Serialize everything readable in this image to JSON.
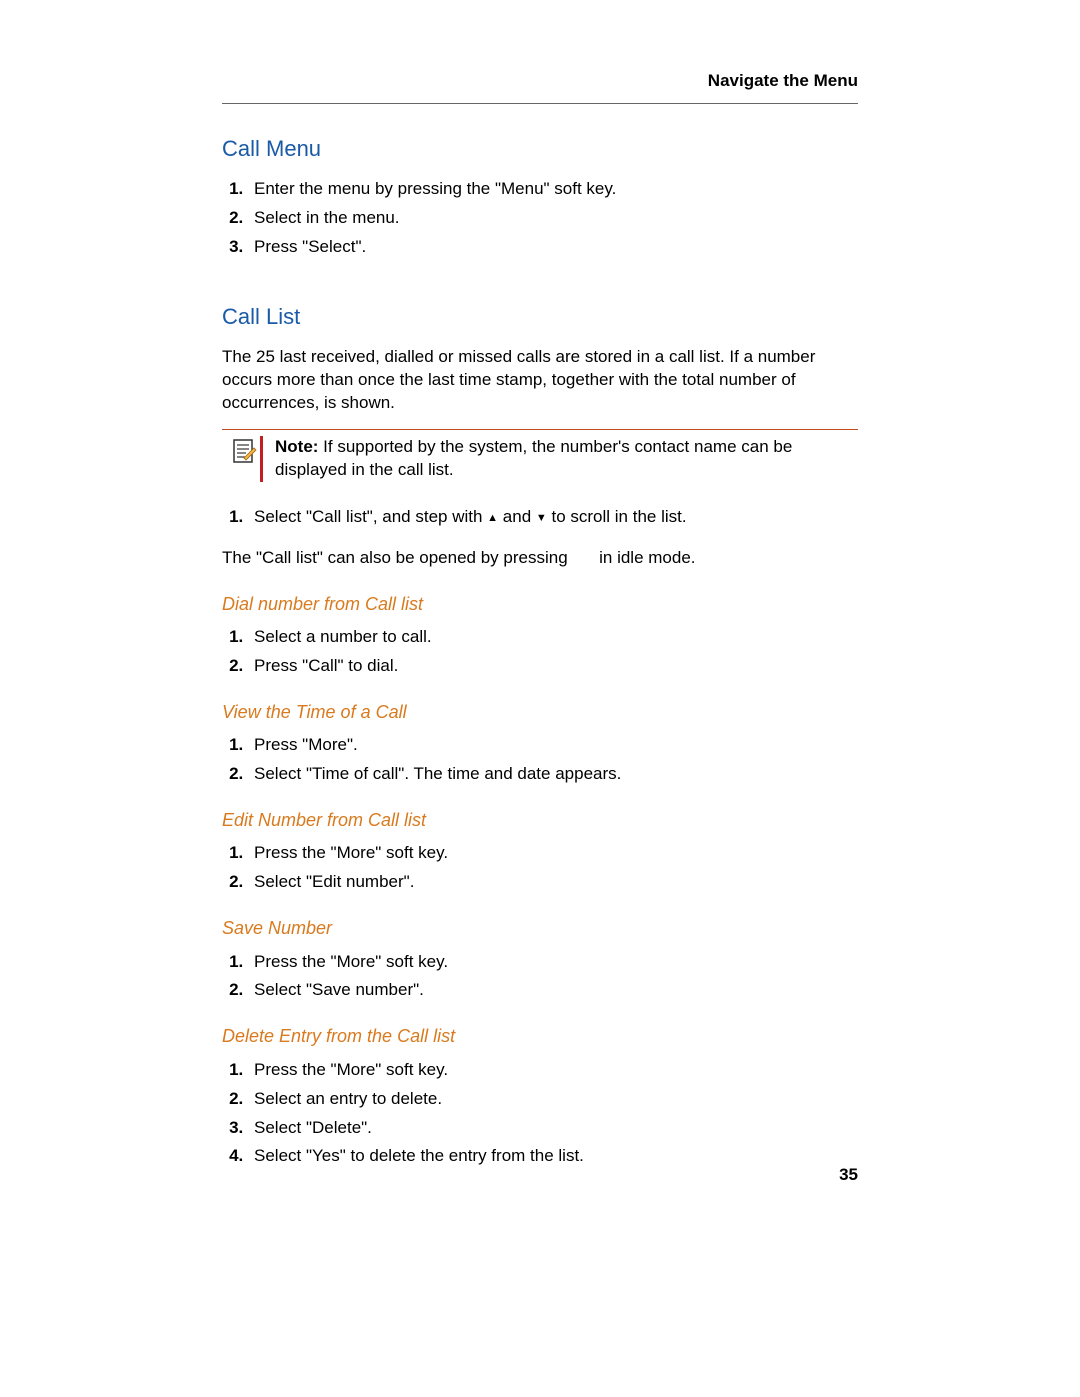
{
  "header": {
    "title": "Navigate the Menu"
  },
  "page_number": "35",
  "sections": {
    "call_menu": {
      "heading": "Call Menu",
      "steps": [
        "Enter the menu by pressing the \"Menu\" soft key.",
        "Select      in the menu.",
        "Press \"Select\"."
      ]
    },
    "call_list": {
      "heading": "Call List",
      "intro": "The 25 last received, dialled or missed calls are stored in a call list. If a number occurs more than once the last time stamp, together with the total number of occurrences, is shown.",
      "note_label": "Note:",
      "note_text": " If supported by the system, the number's contact name can be displayed in the call list.",
      "step1_pre": "Select \"Call list\", and step with ",
      "step1_mid": " and ",
      "step1_post": " to scroll in the list.",
      "idle_pre": "The \"Call list\" can also be opened by pressing ",
      "idle_post": " in idle mode."
    },
    "dial_number": {
      "heading": "Dial number from Call list",
      "steps": [
        "Select a number to call.",
        "Press \"Call\" to dial."
      ]
    },
    "view_time": {
      "heading": "View the Time of a Call",
      "steps": [
        "Press \"More\".",
        "Select \"Time of call\". The time and date appears."
      ]
    },
    "edit_number": {
      "heading": "Edit Number from Call list",
      "steps": [
        "Press the \"More\" soft key.",
        "Select \"Edit number\"."
      ]
    },
    "save_number": {
      "heading": "Save Number",
      "steps": [
        "Press the \"More\" soft key.",
        "Select \"Save number\"."
      ]
    },
    "delete_entry": {
      "heading": "Delete Entry from the Call list",
      "steps": [
        "Press the \"More\" soft key.",
        "Select an entry to delete.",
        "Select \"Delete\".",
        "Select \"Yes\" to delete the entry from the list."
      ]
    }
  }
}
